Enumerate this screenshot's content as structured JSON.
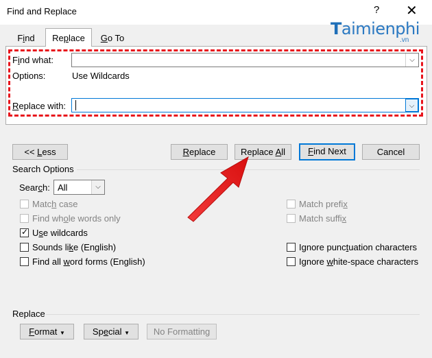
{
  "window": {
    "title": "Find and Replace",
    "help": "?",
    "close": "✕"
  },
  "watermark": {
    "brand": "aimienphi",
    "brand_initial": "T",
    "tld": ".vn"
  },
  "tabs": [
    {
      "label": "Find"
    },
    {
      "label": "Replace"
    },
    {
      "label": "Go To"
    }
  ],
  "find": {
    "label": "Find what:",
    "value": ""
  },
  "options": {
    "label": "Options:",
    "value": "Use Wildcards"
  },
  "replace": {
    "label": "Replace with:",
    "value": ""
  },
  "buttons": {
    "less": "<< Less",
    "replace": "Replace",
    "replace_all": "Replace All",
    "find_next": "Find Next",
    "cancel": "Cancel"
  },
  "search_options": {
    "heading": "Search Options",
    "search_label": "Search:",
    "search_value": "All",
    "left": [
      {
        "label": "Match case",
        "checked": false,
        "disabled": true
      },
      {
        "label": "Find whole words only",
        "checked": false,
        "disabled": true
      },
      {
        "label": "Use wildcards",
        "checked": true,
        "disabled": false
      },
      {
        "label": "Sounds like (English)",
        "checked": false,
        "disabled": false
      },
      {
        "label": "Find all word forms (English)",
        "checked": false,
        "disabled": false
      }
    ],
    "right": [
      {
        "label": "Match prefix",
        "checked": false,
        "disabled": true
      },
      {
        "label": "Match suffix",
        "checked": false,
        "disabled": true
      },
      {
        "label": "Ignore punctuation characters",
        "checked": false,
        "disabled": false
      },
      {
        "label": "Ignore white-space characters",
        "checked": false,
        "disabled": false
      }
    ]
  },
  "replace_section": {
    "heading": "Replace",
    "format": "Format",
    "special": "Special",
    "no_formatting": "No Formatting"
  },
  "annotation": {
    "color": "#e8131b"
  }
}
